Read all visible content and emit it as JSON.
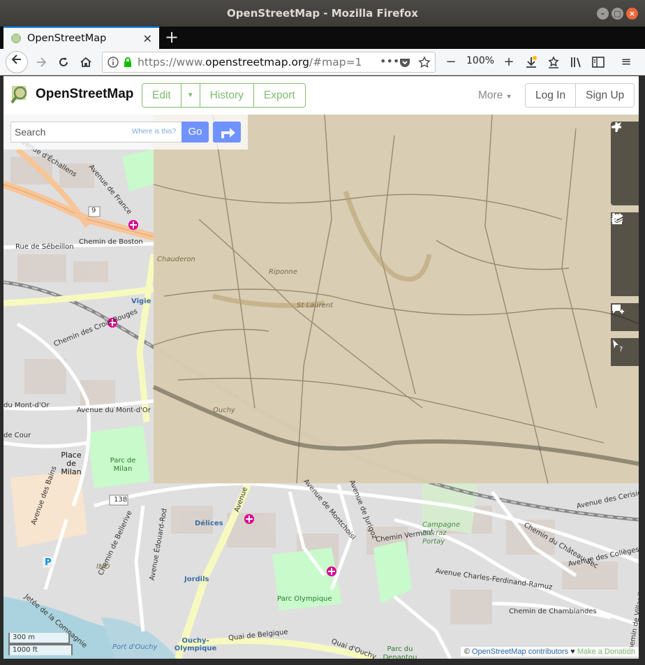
{
  "window": {
    "title": "OpenStreetMap - Mozilla Firefox"
  },
  "tab": {
    "title": "OpenStreetMap"
  },
  "address": {
    "scheme": "https://www.",
    "host": "openstreetmap.org",
    "path": "/#map=15/4",
    "zoom": "100%"
  },
  "header": {
    "brand": "OpenStreetMap",
    "edit_label": "Edit",
    "history_label": "History",
    "export_label": "Export",
    "more_label": "More",
    "login_label": "Log In",
    "signup_label": "Sign Up"
  },
  "search": {
    "placeholder": "Search",
    "where_label": "Where is this?",
    "go_label": "Go"
  },
  "map_labels": {
    "avenue_echallens": "Avenue d'Échallens",
    "avenue_france": "Avenue de France",
    "route_9": "9",
    "chemin_boston": "Chemin de Boston",
    "rue_sebeillon": "Rue de Sébeillon",
    "chauderon": "Chauderon",
    "vigie": "Vigie",
    "chemin_croix_rouges": "Chemin des Croix-Rouges",
    "avenue_mont_or_left": "du Mont-d'Or",
    "avenue_mont_or": "Avenue du Mont-d'Or",
    "de_cour": "de Cour",
    "place_milan": "Place de Milan",
    "parc_milan": "Parc de Milan",
    "route_138": "138",
    "avenue_bains": "Avenue des Bains",
    "chemin_bellerive": "Chemin de Bellerive",
    "avenue_edouard_rod": "Avenue Édouard-Rod",
    "imd": "IMD",
    "delices": "Délices",
    "jordils": "Jordils",
    "avenue_montchoisi": "Avenue de Montchoisi",
    "avenue_jurigoz": "Avenue de Jurigoz",
    "chemin_vermont": "Chemin Vermont",
    "campagne_pierraz": "Campagne Pierraz Portay",
    "avenue_cerisiers": "Avenue des Cerisiers",
    "chemin_chateau_sec": "Chemin du Château-Sec",
    "avenue_colleges": "Avenue des Collèges",
    "av_charles_ferdinand": "Avenue Charles-Ferdinand-Ramuz",
    "chemin_chamblandes": "Chemin de Chamblandes",
    "chemin_villardin": "Chemin de Villardin",
    "parc_olympique": "Parc Olympique",
    "jetee_compagnie": "Jetée de la Compagnie",
    "port_ouchy": "Port d'Ouchy",
    "ouchy_olympique": "Ouchy-Olympique",
    "quai_belgique": "Quai de Belgique",
    "quai_ouchy": "Quai d'Ouchy",
    "parc_denantou": "Parc du Denantou",
    "avenue": "Avenue",
    "parking": "P",
    "historic_centre": "St Laurent",
    "historic_riponne": "Riponne",
    "historic_ouchy": "Ouchy",
    "historic_chauderon": "Chauderon"
  },
  "scale": {
    "metric": "300 m",
    "imperial": "1000 ft"
  },
  "attribution": {
    "copyright": "©",
    "contributors": "OpenStreetMap contributors",
    "heart": "♥",
    "donate": "Make a Donation"
  },
  "icons": {
    "back": "back-arrow-icon",
    "forward": "forward-arrow-icon",
    "reload": "reload-icon",
    "home": "home-icon",
    "zoom_in": "plus-icon",
    "zoom_out": "minus-icon",
    "locate": "locate-icon",
    "layers": "layers-icon",
    "info": "info-icon",
    "share": "share-icon",
    "note": "add-note-icon",
    "query": "query-features-icon"
  },
  "colors": {
    "osm_green": "#7ebc6f",
    "go_blue": "#7092ff",
    "firefox_blue": "#0a84ff"
  }
}
